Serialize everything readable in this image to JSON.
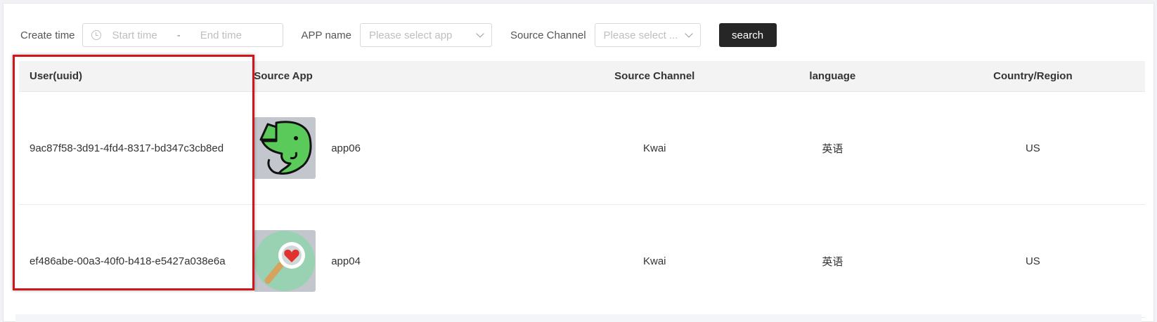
{
  "filters": {
    "create_time_label": "Create time",
    "start_placeholder": "Start time",
    "range_separator": "-",
    "end_placeholder": "End time",
    "app_name_label": "APP name",
    "app_placeholder": "Please select app",
    "source_channel_label": "Source Channel",
    "channel_placeholder": "Please select ...",
    "search_label": "search"
  },
  "table": {
    "headers": [
      "User(uuid)",
      "Source App",
      "Source Channel",
      "language",
      "Country/Region"
    ],
    "rows": [
      {
        "uuid": "9ac87f58-3d91-4fd4-8317-bd347c3cb8ed",
        "app_icon": "elephant-icon",
        "app": "app06",
        "channel": "Kwai",
        "language": "英语",
        "country": "US"
      },
      {
        "uuid": "ef486abe-00a3-40f0-b418-e5427a038e6a",
        "app_icon": "magnifier-heart-icon",
        "app": "app04",
        "channel": "Kwai",
        "language": "英语",
        "country": "US"
      }
    ]
  },
  "colors": {
    "highlight": "#d0161b",
    "button": "#262626",
    "header_bg": "#f3f3f3"
  }
}
